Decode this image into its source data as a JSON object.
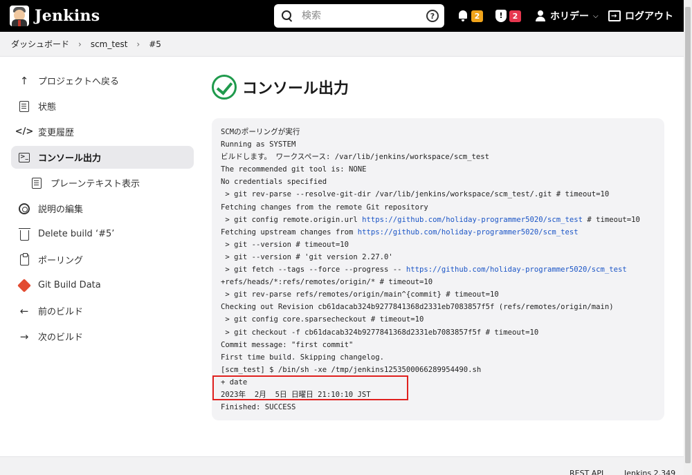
{
  "header": {
    "app_name": "Jenkins",
    "search_placeholder": "検索",
    "help_glyph": "?",
    "notifications_count": "2",
    "security_count": "2",
    "user_name": "ホリデー",
    "logout_label": "ログアウト"
  },
  "breadcrumb": [
    "ダッシュボード",
    "scm_test",
    "#5"
  ],
  "sidebar": {
    "items": [
      {
        "label": "プロジェクトへ戻る",
        "icon": "arrow-up-icon"
      },
      {
        "label": "状態",
        "icon": "document-icon"
      },
      {
        "label": "変更履歴",
        "icon": "code-icon"
      },
      {
        "label": "コンソール出力",
        "icon": "terminal-icon"
      },
      {
        "label": "プレーンテキスト表示",
        "icon": "document-icon"
      },
      {
        "label": "説明の編集",
        "icon": "gear-icon"
      },
      {
        "label": "Delete build ‘#5’",
        "icon": "trash-icon"
      },
      {
        "label": "ポーリング",
        "icon": "clipboard-icon"
      },
      {
        "label": "Git Build Data",
        "icon": "git-icon"
      },
      {
        "label": "前のビルド",
        "icon": "arrow-left-icon"
      },
      {
        "label": "次のビルド",
        "icon": "arrow-right-icon"
      }
    ]
  },
  "main": {
    "title": "コンソール出力",
    "console_lines": [
      {
        "text": "SCMのポーリングが実行"
      },
      {
        "text": "Running as SYSTEM"
      },
      {
        "text": "ビルドします。 ワークスペース: /var/lib/jenkins/workspace/scm_test"
      },
      {
        "text": "The recommended git tool is: NONE"
      },
      {
        "text": "No credentials specified"
      },
      {
        "text": " > git rev-parse --resolve-git-dir /var/lib/jenkins/workspace/scm_test/.git # timeout=10"
      },
      {
        "text": "Fetching changes from the remote Git repository"
      },
      {
        "text": " > git config remote.origin.url ",
        "link": "https://github.com/holiday-programmer5020/scm_test",
        "after": " # timeout=10"
      },
      {
        "text": "Fetching upstream changes from ",
        "link": "https://github.com/holiday-programmer5020/scm_test",
        "after": ""
      },
      {
        "text": " > git --version # timeout=10"
      },
      {
        "text": " > git --version # 'git version 2.27.0'"
      },
      {
        "text": " > git fetch --tags --force --progress -- ",
        "link": "https://github.com/holiday-programmer5020/scm_test",
        "after": ""
      },
      {
        "text": "+refs/heads/*:refs/remotes/origin/* # timeout=10"
      },
      {
        "text": " > git rev-parse refs/remotes/origin/main^{commit} # timeout=10"
      },
      {
        "text": "Checking out Revision cb61dacab324b9277841368d2331eb7083857f5f (refs/remotes/origin/main)"
      },
      {
        "text": " > git config core.sparsecheckout # timeout=10"
      },
      {
        "text": " > git checkout -f cb61dacab324b9277841368d2331eb7083857f5f # timeout=10"
      },
      {
        "text": "Commit message: \"first commit\""
      },
      {
        "text": "First time build. Skipping changelog."
      },
      {
        "text": "[scm_test] $ /bin/sh -xe /tmp/jenkins1253500066289954490.sh"
      },
      {
        "text": "+ date"
      },
      {
        "text": "2023年  2月  5日 日曜日 21:10:10 JST"
      },
      {
        "text": "Finished: SUCCESS"
      }
    ]
  },
  "footer": {
    "rest_api": "REST API",
    "version": "Jenkins 2.349"
  },
  "colors": {
    "header_bg": "#000000",
    "success_green": "#1f9a4c",
    "link_blue": "#1b55c6",
    "highlight_red": "#e0201e",
    "badge_orange": "#f0a41b",
    "badge_red": "#e6374f"
  }
}
